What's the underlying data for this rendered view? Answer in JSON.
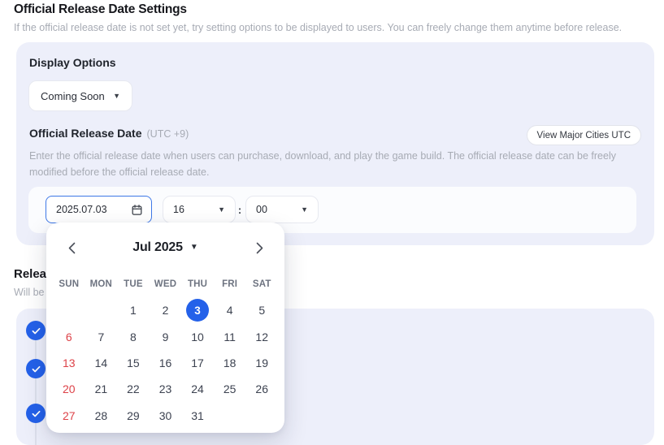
{
  "header": {
    "title": "Official Release Date Settings",
    "subtitle": "If the official release date is not set yet, try setting options to be displayed to users. You can freely change them anytime before release."
  },
  "display_options": {
    "label": "Display Options",
    "selected": "Coming Soon"
  },
  "release_date": {
    "label": "Official Release Date",
    "timezone": "(UTC +9)",
    "view_cities_button": "View Major Cities UTC",
    "description": "Enter the official release date when users can purchase, download, and play the game build. The official release date can be freely modified before the official release date.",
    "date_value": "2025.07.03",
    "hour": "16",
    "time_separator": ":",
    "minute": "00"
  },
  "section2": {
    "title": "Releas",
    "subtitle": "Will be r"
  },
  "calendar": {
    "title": "Jul 2025",
    "weekdays": [
      "SUN",
      "MON",
      "TUE",
      "WED",
      "THU",
      "FRI",
      "SAT"
    ],
    "weeks": [
      [
        "",
        "",
        "1",
        "2",
        "3",
        "4",
        "5"
      ],
      [
        "6",
        "7",
        "8",
        "9",
        "10",
        "11",
        "12"
      ],
      [
        "13",
        "14",
        "15",
        "16",
        "17",
        "18",
        "19"
      ],
      [
        "20",
        "21",
        "22",
        "23",
        "24",
        "25",
        "26"
      ],
      [
        "27",
        "28",
        "29",
        "30",
        "31",
        "",
        ""
      ]
    ],
    "selected_day": "3"
  },
  "timeline": {
    "completed_steps": 3
  },
  "colors": {
    "accent": "#2461e9",
    "sunday_red": "#dd4248",
    "panel_background": "#edeffa",
    "focused_border": "#3e78e7"
  }
}
